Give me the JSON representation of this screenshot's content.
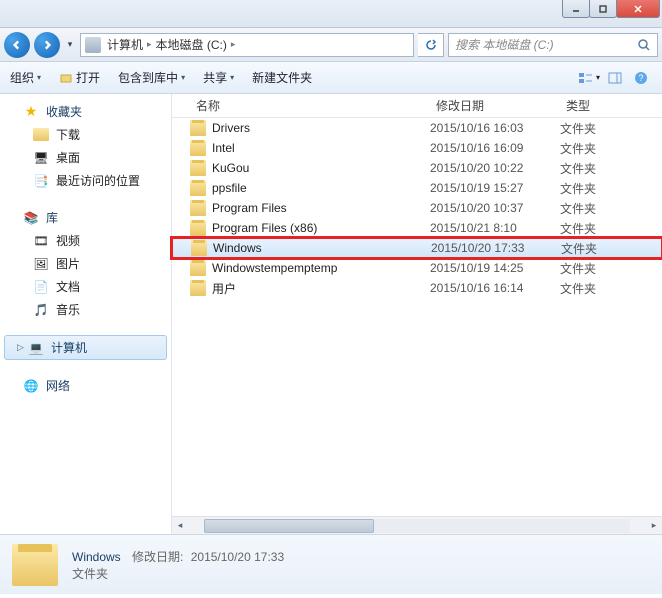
{
  "window": {
    "title": ""
  },
  "nav": {
    "crumbs": [
      "计算机",
      "本地磁盘 (C:)"
    ],
    "search_placeholder": "搜索 本地磁盘 (C:)"
  },
  "toolbar": {
    "organize": "组织",
    "open": "打开",
    "include": "包含到库中",
    "share": "共享",
    "new_folder": "新建文件夹"
  },
  "sidebar": {
    "favorites": {
      "label": "收藏夹",
      "items": [
        "下载",
        "桌面",
        "最近访问的位置"
      ]
    },
    "libraries": {
      "label": "库",
      "items": [
        "视频",
        "图片",
        "文档",
        "音乐"
      ]
    },
    "computer": {
      "label": "计算机"
    },
    "network": {
      "label": "网络"
    }
  },
  "columns": {
    "name": "名称",
    "date": "修改日期",
    "type": "类型"
  },
  "files": [
    {
      "name": "Drivers",
      "date": "2015/10/16 16:03",
      "type": "文件夹"
    },
    {
      "name": "Intel",
      "date": "2015/10/16 16:09",
      "type": "文件夹"
    },
    {
      "name": "KuGou",
      "date": "2015/10/20 10:22",
      "type": "文件夹"
    },
    {
      "name": "ppsfile",
      "date": "2015/10/19 15:27",
      "type": "文件夹"
    },
    {
      "name": "Program Files",
      "date": "2015/10/20 10:37",
      "type": "文件夹"
    },
    {
      "name": "Program Files (x86)",
      "date": "2015/10/21 8:10",
      "type": "文件夹"
    },
    {
      "name": "Windows",
      "date": "2015/10/20 17:33",
      "type": "文件夹",
      "selected": true
    },
    {
      "name": "Windowstempemptemp",
      "date": "2015/10/19 14:25",
      "type": "文件夹"
    },
    {
      "name": "用户",
      "date": "2015/10/16 16:14",
      "type": "文件夹"
    }
  ],
  "details": {
    "name": "Windows",
    "date_label": "修改日期:",
    "date": "2015/10/20 17:33",
    "type": "文件夹"
  }
}
